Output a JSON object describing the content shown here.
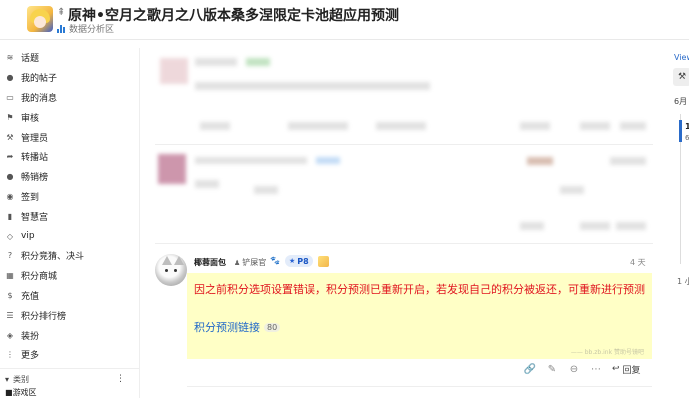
{
  "header": {
    "title": "原神•空月之歌月之八版本桑多涅限定卡池超应用预测",
    "category": "数据分析区",
    "pinned_icon": "pin-icon",
    "chart_icon_color": "#2a7ad4"
  },
  "sidebar": {
    "items": [
      {
        "label": "话题",
        "icon": "layers-icon"
      },
      {
        "label": "我的帖子",
        "icon": "user-icon"
      },
      {
        "label": "我的消息",
        "icon": "inbox-icon"
      },
      {
        "label": "审核",
        "icon": "flag-icon"
      },
      {
        "label": "管理员",
        "icon": "wrench-icon"
      },
      {
        "label": "转播站",
        "icon": "share-icon"
      },
      {
        "label": "畅销榜",
        "icon": "apple-icon"
      },
      {
        "label": "签到",
        "icon": "check-circle-icon"
      },
      {
        "label": "智慧宫",
        "icon": "book-icon"
      },
      {
        "label": "vip",
        "icon": "diamond-icon"
      },
      {
        "label": "积分竞猜、决斗",
        "icon": "question-icon"
      },
      {
        "label": "积分商城",
        "icon": "store-icon"
      },
      {
        "label": "充值",
        "icon": "dollar-icon"
      },
      {
        "label": "积分排行榜",
        "icon": "ranking-icon"
      },
      {
        "label": "装扮",
        "icon": "palette-icon"
      },
      {
        "label": "更多",
        "icon": "more-icon"
      }
    ],
    "section_label": "类别",
    "section_toggle": "▾",
    "section_more": "⋮",
    "last_item": "游戏区"
  },
  "post": {
    "username": "椰蓉面包",
    "user_title": "铲屎官",
    "level": "P8",
    "date": "4 天",
    "notice": "因之前积分选项设置错误，积分预测已重新开启，若发现自己的积分被返还，可重新进行预测",
    "link_text": "积分预测链接",
    "link_clicks": "80",
    "watermark": "—— bb.zb.ink 赞助号镜吧",
    "reply_label": "回复",
    "notice_text_color": "#e0141e",
    "notice_bg_color": "#ffffc6",
    "link_color": "#1f67c9"
  },
  "right": {
    "view_link": "View",
    "month": "6月",
    "progress_top": "1",
    "progress_sub": "6",
    "bottom_text": "1 小"
  }
}
